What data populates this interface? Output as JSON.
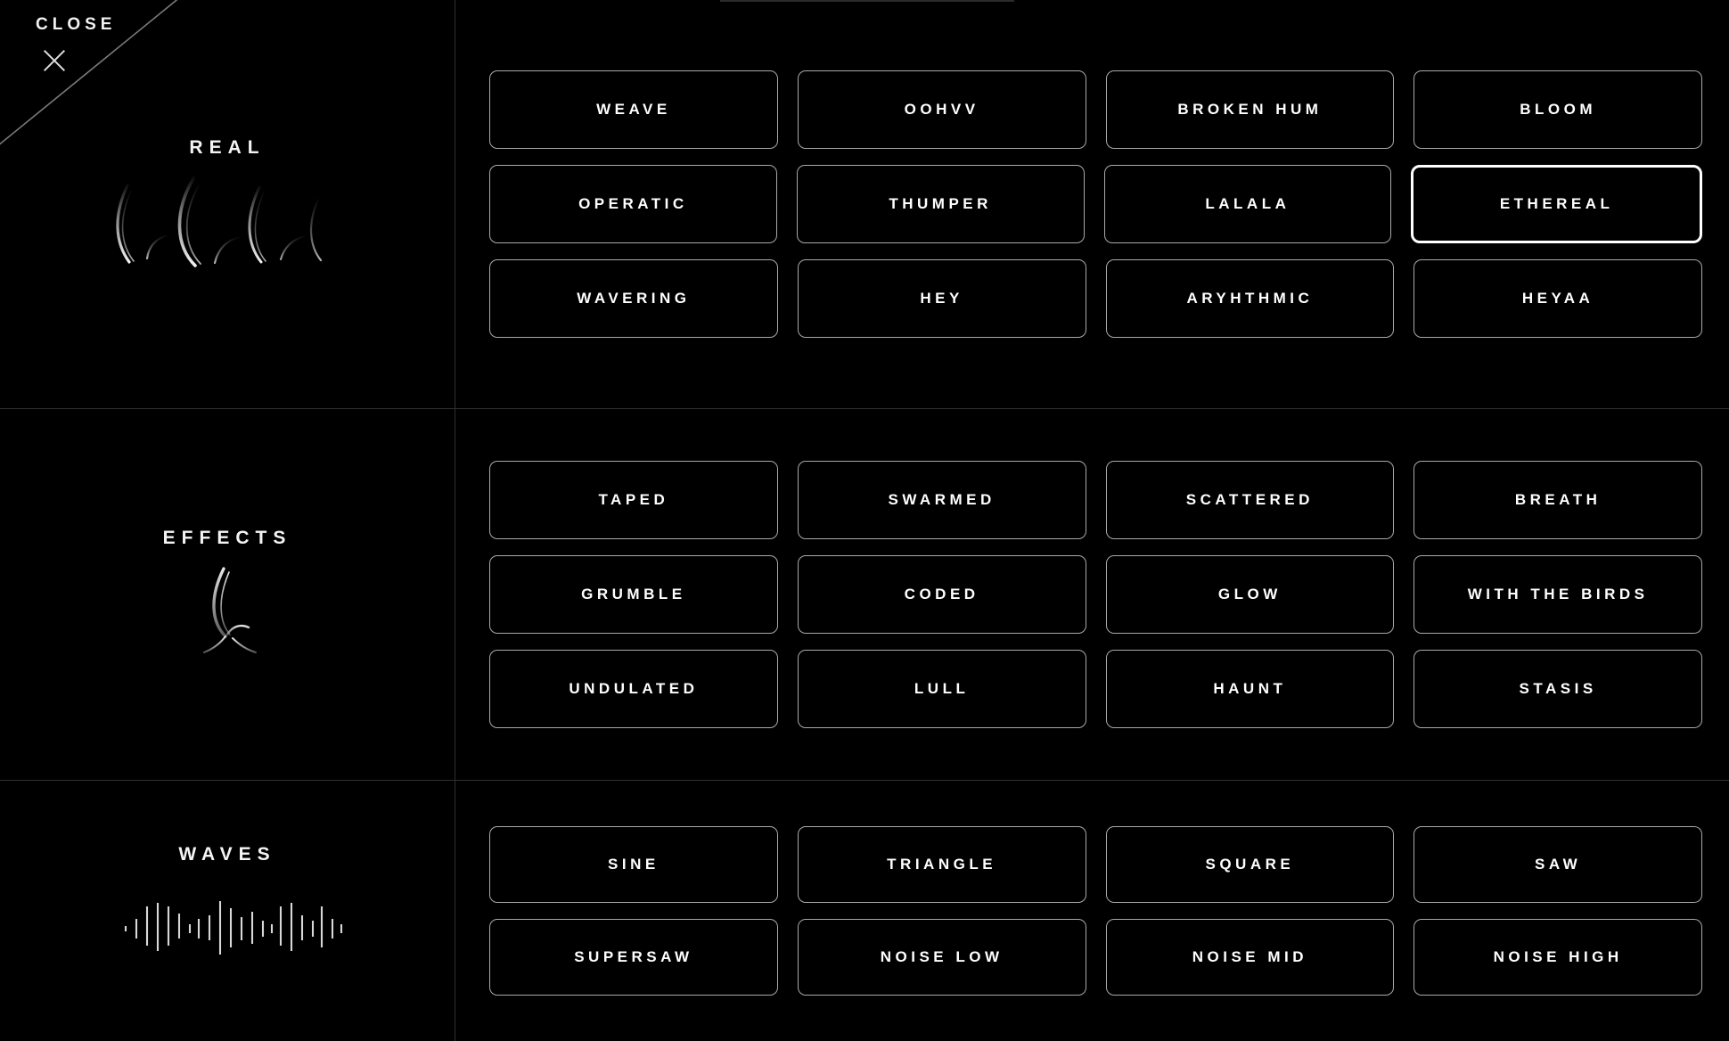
{
  "window": {
    "background_color": "#000000",
    "accent_color": "#ffffff",
    "border_color": "#a9a9a9"
  },
  "close_control": {
    "label": "CLOSE",
    "icon": "close-x-icon"
  },
  "sections": [
    {
      "id": "real",
      "title": "REAL",
      "artwork": "arcs-waveform-graphic",
      "rows": [
        [
          {
            "label": "WEAVE",
            "selected": false
          },
          {
            "label": "OOHVV",
            "selected": false
          },
          {
            "label": "BROKEN HUM",
            "selected": false
          },
          {
            "label": "BLOOM",
            "selected": false
          }
        ],
        [
          {
            "label": "OPERATIC",
            "selected": false
          },
          {
            "label": "THUMPER",
            "selected": false
          },
          {
            "label": "LALALA",
            "selected": false
          },
          {
            "label": "ETHEREAL",
            "selected": true
          }
        ],
        [
          {
            "label": "WAVERING",
            "selected": false
          },
          {
            "label": "HEY",
            "selected": false
          },
          {
            "label": "ARYHTHMIC",
            "selected": false
          },
          {
            "label": "HEYAA",
            "selected": false
          }
        ]
      ]
    },
    {
      "id": "effects",
      "title": "EFFECTS",
      "artwork": "radial-streaks-graphic",
      "rows": [
        [
          {
            "label": "TAPED",
            "selected": false
          },
          {
            "label": "SWARMED",
            "selected": false
          },
          {
            "label": "SCATTERED",
            "selected": false
          },
          {
            "label": "BREATH",
            "selected": false
          }
        ],
        [
          {
            "label": "GRUMBLE",
            "selected": false
          },
          {
            "label": "CODED",
            "selected": false
          },
          {
            "label": "GLOW",
            "selected": false
          },
          {
            "label": "WITH THE BIRDS",
            "selected": false
          }
        ],
        [
          {
            "label": "UNDULATED",
            "selected": false
          },
          {
            "label": "LULL",
            "selected": false
          },
          {
            "label": "HAUNT",
            "selected": false
          },
          {
            "label": "STASIS",
            "selected": false
          }
        ]
      ]
    },
    {
      "id": "waves",
      "title": "WAVES",
      "artwork": "vertical-bars-waveform-graphic",
      "rows": [
        [
          {
            "label": "SINE",
            "selected": false
          },
          {
            "label": "TRIANGLE",
            "selected": false
          },
          {
            "label": "SQUARE",
            "selected": false
          },
          {
            "label": "SAW",
            "selected": false
          }
        ],
        [
          {
            "label": "SUPERSAW",
            "selected": false
          },
          {
            "label": "NOISE LOW",
            "selected": false
          },
          {
            "label": "NOISE MID",
            "selected": false
          },
          {
            "label": "NOISE HIGH",
            "selected": false
          }
        ]
      ]
    }
  ]
}
